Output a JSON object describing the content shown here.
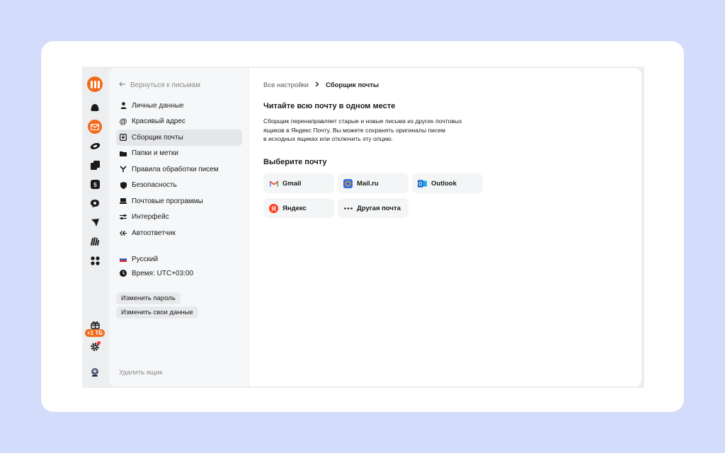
{
  "sidebar": {
    "back_label": "Вернуться к письмам",
    "items": [
      {
        "label": "Личные данные",
        "icon": "person-icon"
      },
      {
        "label": "Красивый адрес",
        "icon": "at-icon"
      },
      {
        "label": "Сборщик почты",
        "icon": "inbox-download-icon",
        "active": true
      },
      {
        "label": "Папки и метки",
        "icon": "folder-icon"
      },
      {
        "label": "Правила обработки писем",
        "icon": "filter-icon"
      },
      {
        "label": "Безопасность",
        "icon": "shield-icon"
      },
      {
        "label": "Почтовые программы",
        "icon": "laptop-icon"
      },
      {
        "label": "Интерфейс",
        "icon": "sliders-icon"
      },
      {
        "label": "Автоответчик",
        "icon": "reply-all-icon"
      }
    ],
    "language": "Русский",
    "time": "Время: UTC+03:00",
    "change_password": "Изменить пароль",
    "change_data": "Изменить свои данные",
    "delete_box": "Удалить ящик"
  },
  "rail": {
    "storage_badge": "+1 ТБ"
  },
  "main": {
    "breadcrumb_root": "Все настройки",
    "breadcrumb_current": "Сборщик почты",
    "title": "Читайте всю почту в одном месте",
    "description_lines": [
      "Сборщик перенаправляет старые и новые письма из других почтовых",
      "ящиков в Яндекс Почту. Вы можете сохранять оригиналы писем",
      "в исходных ящиках или отключить эту опцию."
    ],
    "choose_title": "Выберите почту",
    "providers": [
      {
        "label": "Gmail",
        "icon": "gmail-icon"
      },
      {
        "label": "Mail.ru",
        "icon": "mailru-icon"
      },
      {
        "label": "Outlook",
        "icon": "outlook-icon"
      },
      {
        "label": "Яндекс",
        "icon": "yandex-icon"
      },
      {
        "label": "Другая почта",
        "icon": "more-dots-icon"
      }
    ]
  },
  "colors": {
    "accent": "#f26b1d",
    "background": "#d3dcfa",
    "active_item": "#e5e6e8"
  }
}
